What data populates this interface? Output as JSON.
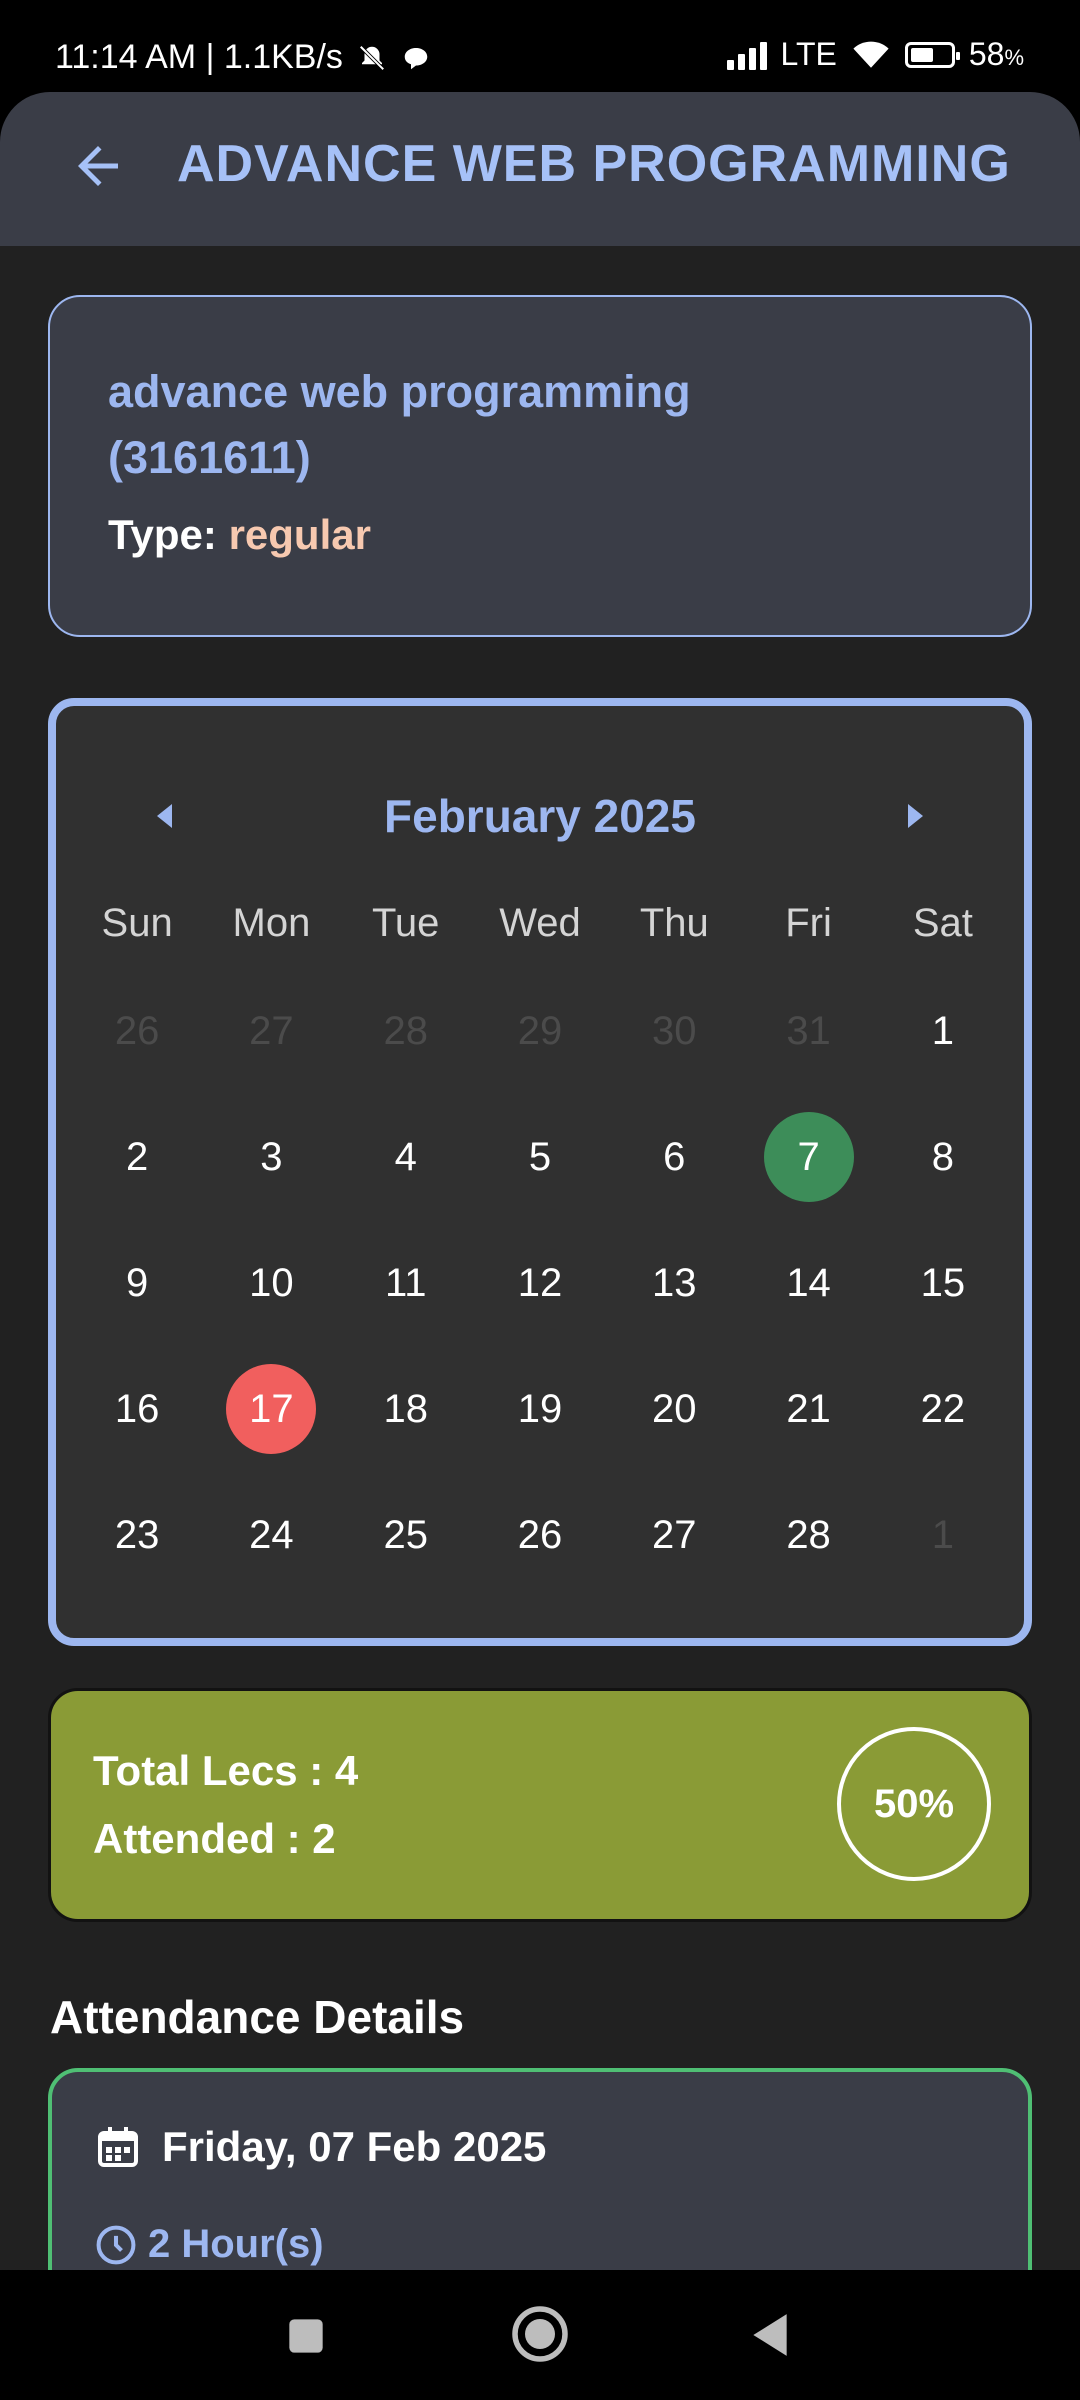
{
  "status_bar": {
    "time_speed": "11:14 AM | 1.1KB/s",
    "network": "LTE",
    "battery_percent": "58",
    "battery_unit": "%",
    "battery_level": 0.58
  },
  "app_bar": {
    "title": "ADVANCE WEB PROGRAMMING",
    "back_icon": "arrow-left-icon"
  },
  "subject": {
    "name": "advance web programming (3161611)",
    "type_label": "Type: ",
    "type_value": "regular"
  },
  "calendar": {
    "month_label": "February 2025",
    "weekdays": [
      "Sun",
      "Mon",
      "Tue",
      "Wed",
      "Thu",
      "Fri",
      "Sat"
    ],
    "days": [
      {
        "d": "26",
        "muted": true
      },
      {
        "d": "27",
        "muted": true
      },
      {
        "d": "28",
        "muted": true
      },
      {
        "d": "29",
        "muted": true
      },
      {
        "d": "30",
        "muted": true
      },
      {
        "d": "31",
        "muted": true
      },
      {
        "d": "1"
      },
      {
        "d": "2"
      },
      {
        "d": "3"
      },
      {
        "d": "4"
      },
      {
        "d": "5"
      },
      {
        "d": "6"
      },
      {
        "d": "7",
        "status": "present"
      },
      {
        "d": "8"
      },
      {
        "d": "9"
      },
      {
        "d": "10"
      },
      {
        "d": "11"
      },
      {
        "d": "12"
      },
      {
        "d": "13"
      },
      {
        "d": "14"
      },
      {
        "d": "15"
      },
      {
        "d": "16"
      },
      {
        "d": "17",
        "status": "absent"
      },
      {
        "d": "18"
      },
      {
        "d": "19"
      },
      {
        "d": "20"
      },
      {
        "d": "21"
      },
      {
        "d": "22"
      },
      {
        "d": "23"
      },
      {
        "d": "24"
      },
      {
        "d": "25"
      },
      {
        "d": "26"
      },
      {
        "d": "27"
      },
      {
        "d": "28"
      },
      {
        "d": "1",
        "muted": true
      }
    ],
    "colors": {
      "present": "#3d8d59",
      "absent": "#f15f5e",
      "accent": "#9db7f0"
    }
  },
  "stats": {
    "total_lecs": "Total Lecs : 4",
    "attended": "Attended : 2",
    "percent": "50%",
    "card_color": "#8a9b36"
  },
  "details": {
    "section_title": "Attendance Details",
    "items": [
      {
        "date": "Friday, 07 Feb 2025",
        "hours": "2 Hour(s)"
      }
    ]
  }
}
